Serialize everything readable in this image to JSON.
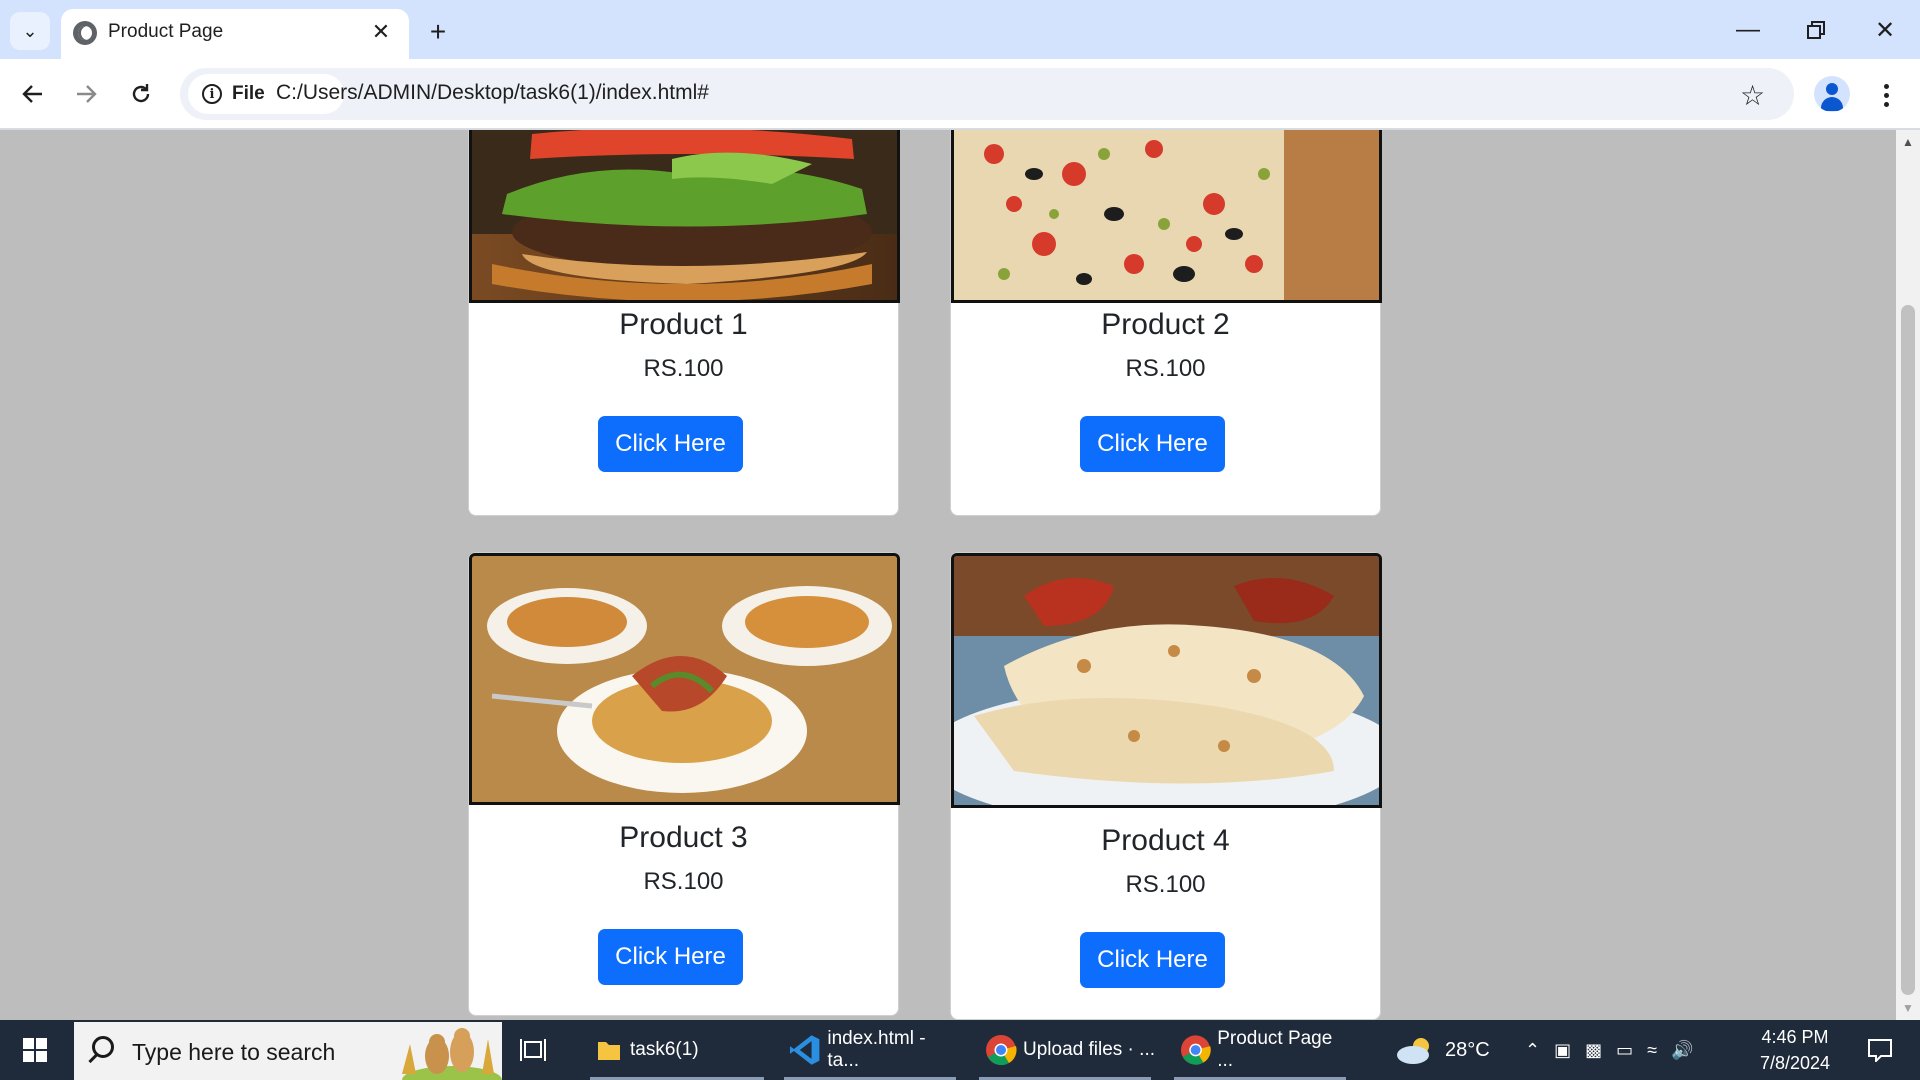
{
  "browser": {
    "tab_title": "Product Page",
    "address_chip": "File",
    "url": "C:/Users/ADMIN/Desktop/task6(1)/index.html#"
  },
  "products": [
    {
      "name": "Product 1",
      "price": "RS.100",
      "button": "Click Here"
    },
    {
      "name": "Product 2",
      "price": "RS.100",
      "button": "Click Here"
    },
    {
      "name": "Product 3",
      "price": "RS.100",
      "button": "Click Here"
    },
    {
      "name": "Product 4",
      "price": "RS.100",
      "button": "Click Here"
    }
  ],
  "taskbar": {
    "search_placeholder": "Type here to search",
    "items": [
      "task6(1)",
      "index.html - ta...",
      "Upload files · ...",
      "Product Page ..."
    ],
    "weather": "28°C",
    "time": "4:46 PM",
    "date": "7/8/2024"
  },
  "colors": {
    "tab_strip": "#d3e3fd",
    "page_background": "#bdbdbd",
    "button_primary": "#0d6efd",
    "taskbar": "#1f2a3a"
  }
}
